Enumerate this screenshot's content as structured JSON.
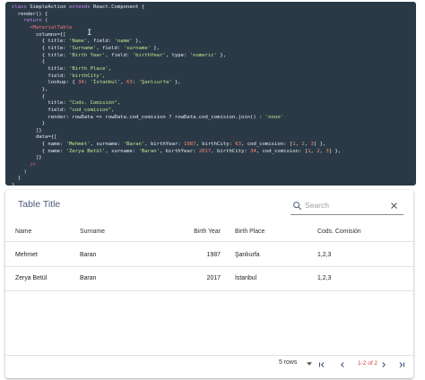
{
  "code": {
    "lines": [
      [
        {
          "t": "class",
          "c": "kw"
        },
        {
          "t": " SimpleAction ",
          "c": ""
        },
        {
          "t": "extends",
          "c": "kw"
        },
        {
          "t": " React.Component {",
          "c": ""
        }
      ],
      [
        {
          "t": "  render() {",
          "c": ""
        }
      ],
      [
        {
          "t": "    ",
          "c": ""
        },
        {
          "t": "return",
          "c": "kw"
        },
        {
          "t": " (",
          "c": ""
        }
      ],
      [
        {
          "t": "      ",
          "c": ""
        },
        {
          "t": "<MaterialTable",
          "c": "tag"
        }
      ],
      [
        {
          "t": "        columns={[",
          "c": ""
        }
      ],
      [
        {
          "t": "          { title: ",
          "c": ""
        },
        {
          "t": "'Name'",
          "c": "str"
        },
        {
          "t": ", field: ",
          "c": ""
        },
        {
          "t": "'name'",
          "c": "str"
        },
        {
          "t": " },",
          "c": ""
        }
      ],
      [
        {
          "t": "          { title: ",
          "c": ""
        },
        {
          "t": "'Surname'",
          "c": "str"
        },
        {
          "t": ", field: ",
          "c": ""
        },
        {
          "t": "'surname'",
          "c": "str"
        },
        {
          "t": " },",
          "c": ""
        }
      ],
      [
        {
          "t": "          { title: ",
          "c": ""
        },
        {
          "t": "'Birth Year'",
          "c": "str"
        },
        {
          "t": ", field: ",
          "c": ""
        },
        {
          "t": "'birthYear'",
          "c": "str"
        },
        {
          "t": ", type: ",
          "c": ""
        },
        {
          "t": "'numeric'",
          "c": "str"
        },
        {
          "t": " },",
          "c": ""
        }
      ],
      [
        {
          "t": "          {",
          "c": ""
        }
      ],
      [
        {
          "t": "            title: ",
          "c": ""
        },
        {
          "t": "'Birth Place'",
          "c": "str"
        },
        {
          "t": ",",
          "c": ""
        }
      ],
      [
        {
          "t": "            field: ",
          "c": ""
        },
        {
          "t": "'birthCity'",
          "c": "str"
        },
        {
          "t": ",",
          "c": ""
        }
      ],
      [
        {
          "t": "            lookup: { ",
          "c": ""
        },
        {
          "t": "34",
          "c": "num"
        },
        {
          "t": ": ",
          "c": ""
        },
        {
          "t": "'İstanbul'",
          "c": "str"
        },
        {
          "t": ", ",
          "c": ""
        },
        {
          "t": "63",
          "c": "num"
        },
        {
          "t": ": ",
          "c": ""
        },
        {
          "t": "'Şanlıurfa'",
          "c": "str"
        },
        {
          "t": " },",
          "c": ""
        }
      ],
      [
        {
          "t": "          },",
          "c": ""
        }
      ],
      [
        {
          "t": "          {",
          "c": ""
        }
      ],
      [
        {
          "t": "            title: ",
          "c": ""
        },
        {
          "t": "\"Cods. Comisión\"",
          "c": "str"
        },
        {
          "t": ",",
          "c": ""
        }
      ],
      [
        {
          "t": "            field: ",
          "c": ""
        },
        {
          "t": "\"cod_comision\"",
          "c": "str"
        },
        {
          "t": ",",
          "c": ""
        }
      ],
      [
        {
          "t": "            render: rowData => rowData.cod_comision ? rowData.cod_comision.join() : ",
          "c": ""
        },
        {
          "t": "'nooo'",
          "c": "str"
        }
      ],
      [
        {
          "t": "          }",
          "c": ""
        }
      ],
      [
        {
          "t": "        ]}",
          "c": ""
        }
      ],
      [
        {
          "t": "        data={[",
          "c": ""
        }
      ],
      [
        {
          "t": "          { name: ",
          "c": ""
        },
        {
          "t": "'Mehmet'",
          "c": "str"
        },
        {
          "t": ", surname: ",
          "c": ""
        },
        {
          "t": "'Baran'",
          "c": "str"
        },
        {
          "t": ", birthYear: ",
          "c": ""
        },
        {
          "t": "1987",
          "c": "num"
        },
        {
          "t": ", birthCity: ",
          "c": ""
        },
        {
          "t": "63",
          "c": "num"
        },
        {
          "t": ", cod_comision: [",
          "c": ""
        },
        {
          "t": "1",
          "c": "num"
        },
        {
          "t": ", ",
          "c": ""
        },
        {
          "t": "2",
          "c": "num"
        },
        {
          "t": ", ",
          "c": ""
        },
        {
          "t": "3",
          "c": "num"
        },
        {
          "t": "] },",
          "c": ""
        }
      ],
      [
        {
          "t": "          { name: ",
          "c": ""
        },
        {
          "t": "'Zerya Betül'",
          "c": "str"
        },
        {
          "t": ", surname: ",
          "c": ""
        },
        {
          "t": "'Baran'",
          "c": "str"
        },
        {
          "t": ", birthYear: ",
          "c": ""
        },
        {
          "t": "2017",
          "c": "num"
        },
        {
          "t": ", birthCity: ",
          "c": ""
        },
        {
          "t": "34",
          "c": "num"
        },
        {
          "t": ", cod_comision: [",
          "c": ""
        },
        {
          "t": "1",
          "c": "num"
        },
        {
          "t": ", ",
          "c": ""
        },
        {
          "t": "2",
          "c": "num"
        },
        {
          "t": ", ",
          "c": ""
        },
        {
          "t": "3",
          "c": "num"
        },
        {
          "t": "] },",
          "c": ""
        }
      ],
      [
        {
          "t": "        ]}",
          "c": ""
        }
      ],
      [
        {
          "t": "      />",
          "c": "tag"
        }
      ],
      [
        {
          "t": "    )",
          "c": ""
        }
      ],
      [
        {
          "t": "  }",
          "c": ""
        }
      ],
      [
        {
          "t": "}",
          "c": ""
        }
      ]
    ]
  },
  "table": {
    "title": "Table Title",
    "search_placeholder": "Search",
    "headers": {
      "name": "Name",
      "surname": "Surname",
      "birth_year": "Birth Year",
      "birth_place": "Birth Place",
      "cods": "Cods. Comisión"
    },
    "rows": [
      {
        "name": "Mehmet",
        "surname": "Baran",
        "birth_year": "1987",
        "birth_place": "Şanlıurfa",
        "cods": "1,2,3"
      },
      {
        "name": "Zerya Betül",
        "surname": "Baran",
        "birth_year": "2017",
        "birth_place": "İstanbul",
        "cods": "1,2,3"
      }
    ],
    "pagination": {
      "rows_per_page": "5 rows",
      "page_info": "1-2 of 2"
    }
  },
  "colors": {
    "code_background": "#2b3947",
    "title_text": "#4a5a7a",
    "page_info_text": "#d23c3c"
  }
}
